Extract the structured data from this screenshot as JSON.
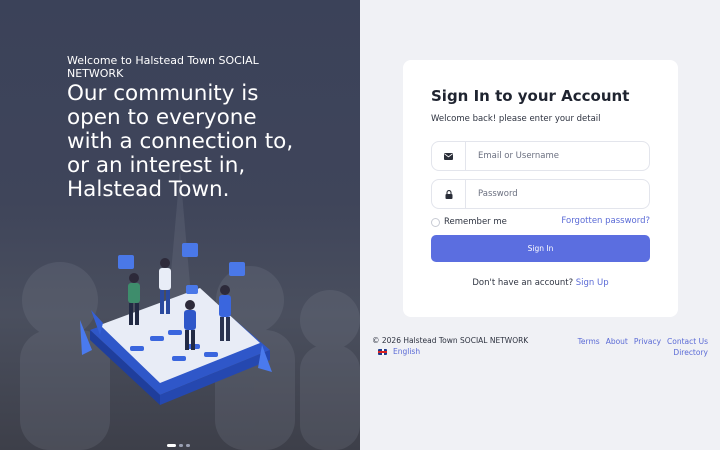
{
  "hero": {
    "subtitle": "Welcome to Halstead Town SOCIAL NETWORK",
    "headline": "Our community is open to everyone with a connection to, or an interest in, Halstead Town.",
    "carousel": {
      "slides": 3,
      "active": 1
    }
  },
  "login": {
    "title": "Sign In to your Account",
    "subtitle": "Welcome back! please enter your detail",
    "email_placeholder": "Email or Username",
    "password_placeholder": "Password",
    "email_icon": "envelope-icon",
    "password_icon": "lock-icon",
    "remember_label": "Remember me",
    "forgot_label": "Forgotten password?",
    "signin_label": "Sign In",
    "signup_prompt": "Don't have an account?",
    "signup_label": "Sign Up"
  },
  "footer": {
    "copyright": "© 2026 Halstead Town SOCIAL NETWORK",
    "language": "English",
    "links": [
      "Terms",
      "About",
      "Privacy",
      "Contact Us",
      "Directory"
    ]
  },
  "colors": {
    "accent": "#5b6ee0",
    "link": "#5b6bd6",
    "hero_bg": "#3f455a",
    "page_bg": "#f0f1f5"
  }
}
